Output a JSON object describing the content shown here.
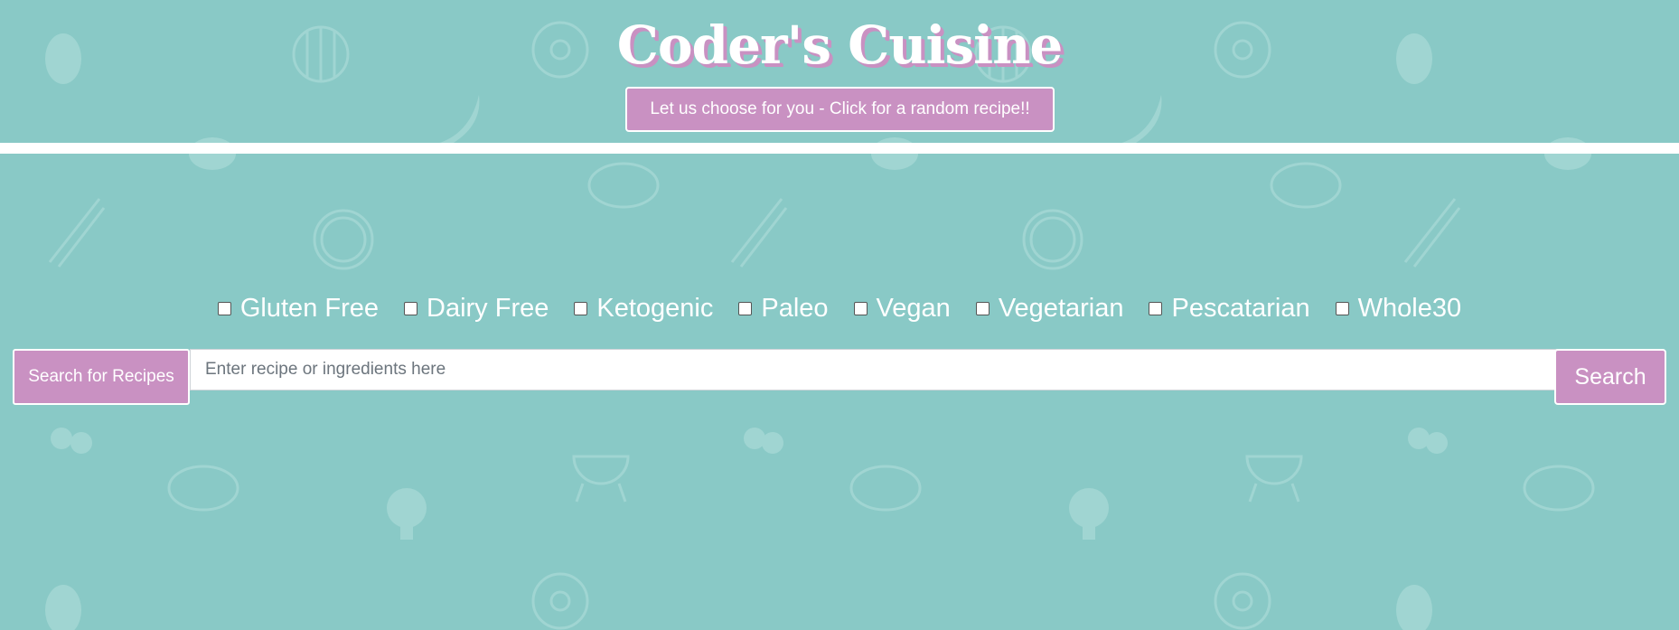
{
  "header": {
    "title": "Coder's Cuisine",
    "random_button_label": "Let us choose for you - Click for a random recipe!!"
  },
  "filters": [
    {
      "label": "Gluten Free",
      "checked": false
    },
    {
      "label": "Dairy Free",
      "checked": false
    },
    {
      "label": "Ketogenic",
      "checked": false
    },
    {
      "label": "Paleo",
      "checked": false
    },
    {
      "label": "Vegan",
      "checked": false
    },
    {
      "label": "Vegetarian",
      "checked": false
    },
    {
      "label": "Pescatarian",
      "checked": false
    },
    {
      "label": "Whole30",
      "checked": false
    }
  ],
  "search": {
    "label": "Search for Recipes",
    "placeholder": "Enter recipe or ingredients here",
    "value": "",
    "button_label": "Search"
  },
  "colors": {
    "background": "#89c9c6",
    "accent": "#c991c2",
    "text_light": "#ffffff"
  },
  "background_icons": [
    "pineapple-icon",
    "watermelon-icon",
    "donut-icon",
    "banana-icon",
    "asparagus-icon",
    "steak-icon",
    "lemon-icon",
    "cherry-icon",
    "grill-icon",
    "broccoli-icon",
    "turkey-icon"
  ]
}
